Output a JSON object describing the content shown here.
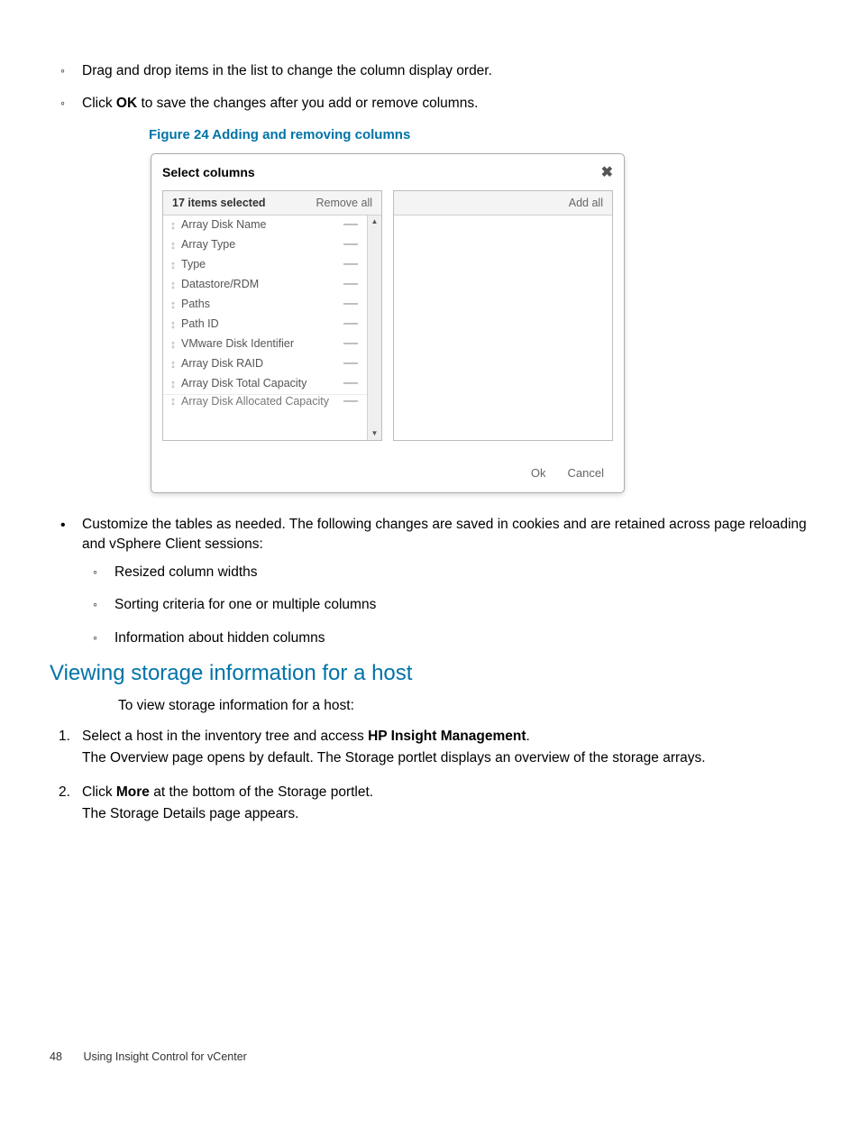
{
  "top_sub_items": [
    "Drag and drop items in the list to change the column display order.",
    {
      "pre": "Click ",
      "bold": "OK",
      "post": " to save the changes after you add or remove columns."
    }
  ],
  "figure_caption": "Figure 24 Adding and removing columns",
  "dialog": {
    "title": "Select columns",
    "left_header": "17 items selected",
    "remove_all": "Remove all",
    "add_all": "Add all",
    "items": [
      "Array Disk Name",
      "Array Type",
      "Type",
      "Datastore/RDM",
      "Paths",
      "Path ID",
      "VMware Disk Identifier",
      "Array Disk RAID",
      "Array Disk Total Capacity",
      "Array Disk Allocated Capacity"
    ],
    "ok": "Ok",
    "cancel": "Cancel"
  },
  "bullet2": {
    "text": "Customize the tables as needed. The following changes are saved in cookies and are retained across page reloading and vSphere Client sessions:",
    "subs": [
      "Resized column widths",
      "Sorting criteria for one or multiple columns",
      "Information about hidden columns"
    ]
  },
  "section_heading": "Viewing storage information for a host",
  "intro": "To view storage information for a host:",
  "steps": [
    {
      "num": "1.",
      "line1_pre": "Select a host in the inventory tree and access ",
      "line1_bold": "HP Insight Management",
      "line1_post": ".",
      "line2": "The Overview page opens by default. The Storage portlet displays an overview of the storage arrays."
    },
    {
      "num": "2.",
      "line1_pre": "Click ",
      "line1_bold": "More",
      "line1_post": " at the bottom of the Storage portlet.",
      "line2": "The Storage Details page appears."
    }
  ],
  "footer": {
    "page": "48",
    "title": "Using Insight Control for vCenter"
  }
}
